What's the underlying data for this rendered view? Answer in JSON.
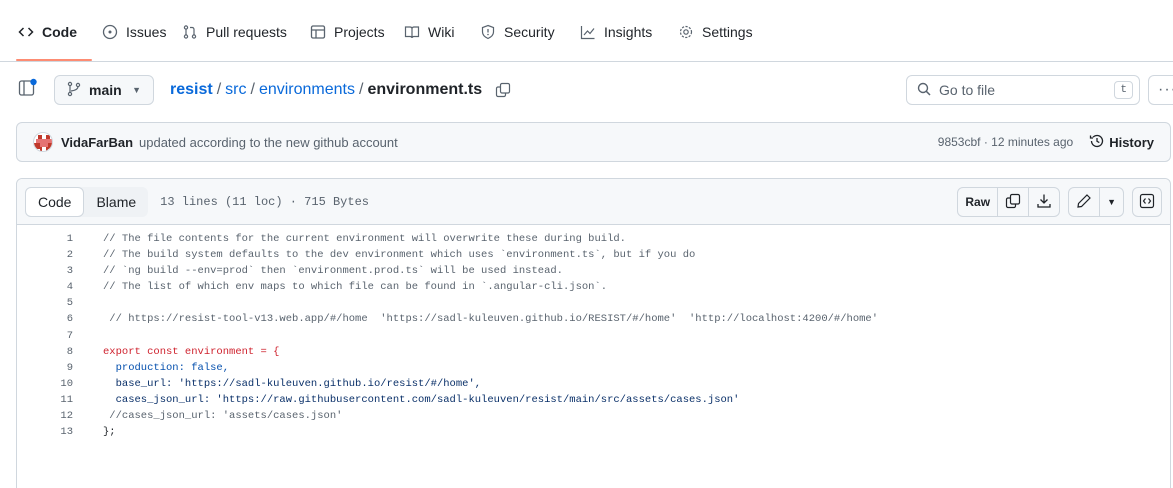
{
  "nav": {
    "tabs": [
      {
        "label": "Code",
        "icon": "code-icon"
      },
      {
        "label": "Issues",
        "icon": "issue-opened-icon"
      },
      {
        "label": "Pull requests",
        "icon": "git-pull-request-icon"
      },
      {
        "label": "Projects",
        "icon": "table-icon"
      },
      {
        "label": "Wiki",
        "icon": "book-icon"
      },
      {
        "label": "Security",
        "icon": "shield-icon"
      },
      {
        "label": "Insights",
        "icon": "graph-icon"
      },
      {
        "label": "Settings",
        "icon": "gear-icon"
      }
    ]
  },
  "branch": {
    "label": "main"
  },
  "breadcrumb": {
    "repo": "resist",
    "sep": "/",
    "parts": [
      "src",
      "environments"
    ],
    "file": "environment.ts"
  },
  "goto": {
    "placeholder": "Go to file",
    "shortcut": "t"
  },
  "more": {
    "label": "···"
  },
  "commit": {
    "author": "VidaFarBan",
    "message": "updated according to the new github account",
    "meta": "9853cbf · 12 minutes ago",
    "history": "History"
  },
  "file": {
    "tab_code": "Code",
    "tab_blame": "Blame",
    "info": "13 lines (11 loc) · 715 Bytes",
    "raw": "Raw"
  },
  "code": {
    "line_numbers": [
      "1",
      "2",
      "3",
      "4",
      "5",
      "6",
      "7",
      "8",
      "9",
      "10",
      "11",
      "12",
      "13"
    ],
    "lines": [
      "// The file contents for the current environment will overwrite these during build.",
      "// The build system defaults to the dev environment which uses `environment.ts`, but if you do",
      "// `ng build --env=prod` then `environment.prod.ts` will be used instead.",
      "// The list of which env maps to which file can be found in `.angular-cli.json`.",
      "",
      " // https://resist-tool-v13.web.app/#/home  'https://sadl-kuleuven.github.io/RESIST/#/home'  'http://localhost:4200/#/home'",
      "",
      "export const environment = {",
      "  production: false,",
      "  base_url: 'https://sadl-kuleuven.github.io/resist/#/home',",
      "  cases_json_url: 'https://raw.githubusercontent.com/sadl-kuleuven/resist/main/src/assets/cases.json'",
      " //cases_json_url: 'assets/cases.json'",
      "};"
    ]
  },
  "colors": {
    "accent_underline": "#fd8c73",
    "link": "#0969da",
    "keyword": "#cf222e",
    "comment": "#59636e",
    "string": "#0a3069"
  }
}
